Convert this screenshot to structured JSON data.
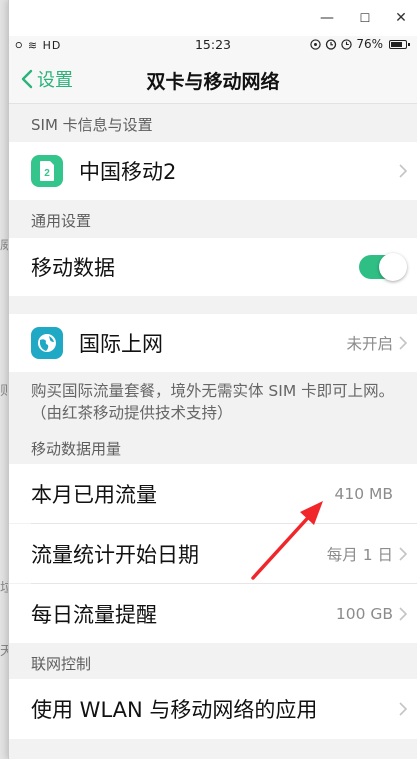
{
  "window": {
    "minimize_glyph": "—",
    "maximize_glyph": "☐",
    "close_glyph": "✕"
  },
  "status_bar": {
    "signal": "᳃ ≋ HD",
    "time": "15:23",
    "battery": "76%",
    "battery_level": 0.76
  },
  "nav": {
    "back_label": "设置",
    "title": "双卡与移动网络"
  },
  "sections": {
    "sim": {
      "header": "SIM 卡信息与设置",
      "sim_name": "中国移动2",
      "sim_badge": "2"
    },
    "general": {
      "header": "通用设置",
      "mobile_data_label": "移动数据",
      "mobile_data_on": true,
      "intl_label": "国际上网",
      "intl_value": "未开启",
      "intl_note": "购买国际流量套餐，境外无需实体 SIM 卡即可上网。（由红茶移动提供技术支持）"
    },
    "usage": {
      "header": "移动数据用量",
      "rows": [
        {
          "label": "本月已用流量",
          "value": "410 MB"
        },
        {
          "label": "流量统计开始日期",
          "value": "每月 1 日"
        },
        {
          "label": "每日流量提醒",
          "value": "100 GB"
        }
      ]
    },
    "network": {
      "header": "联网控制",
      "apps_label": "使用 WLAN 与移动网络的应用"
    }
  },
  "background_fragments": [
    "威",
    "则",
    "垃",
    "天"
  ],
  "colors": {
    "accent": "#2bb37a",
    "annotation_arrow": "#f0262b"
  }
}
